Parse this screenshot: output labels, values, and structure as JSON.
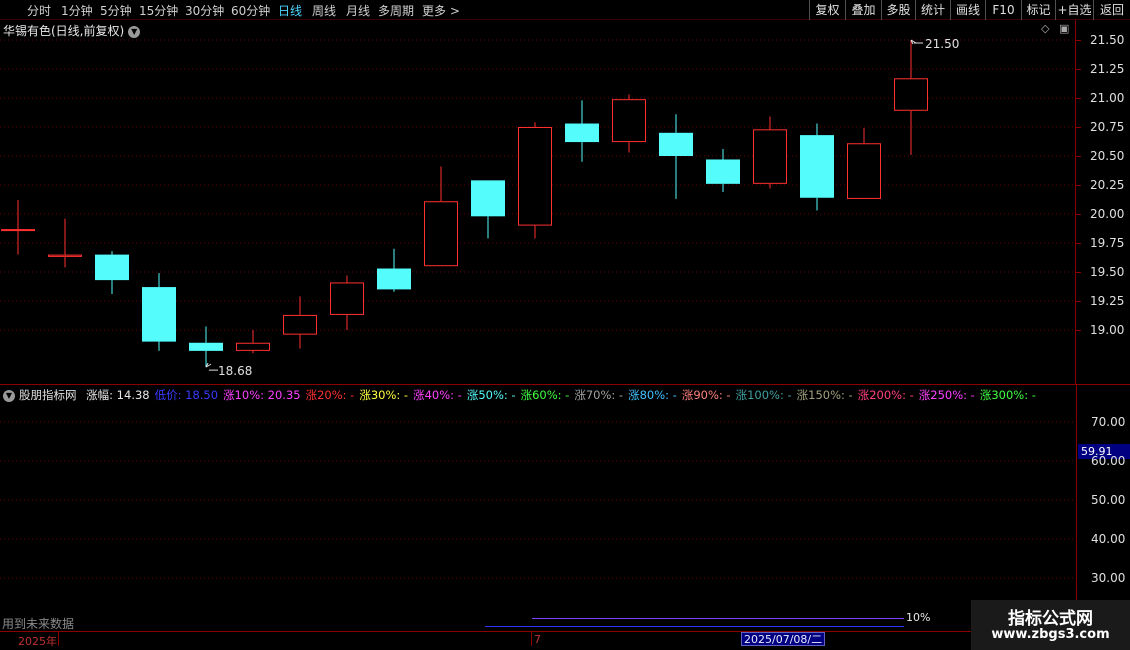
{
  "toolbar": {
    "periods": [
      "分时",
      "1分钟",
      "5分钟",
      "15分钟",
      "30分钟",
      "60分钟",
      "日线",
      "周线",
      "月线",
      "多周期",
      "更多 >"
    ],
    "active_period": "日线",
    "actions": [
      "复权",
      "叠加",
      "多股",
      "统计",
      "画线",
      "F10",
      "标记",
      "+自选",
      "返回"
    ]
  },
  "main": {
    "title": "华锡有色(日线,前复权)",
    "high_label": "21.50",
    "low_label": "18.68",
    "y_ticks": [
      "21.50",
      "21.25",
      "21.00",
      "20.75",
      "20.50",
      "20.25",
      "20.00",
      "19.75",
      "19.50",
      "19.25",
      "19.00"
    ]
  },
  "chart_data": {
    "type": "candlestick",
    "ylim": [
      18.6,
      21.7
    ],
    "up_color": "#ff3030",
    "down_color": "#54fcfc",
    "candles": [
      {
        "o": 19.87,
        "h": 20.12,
        "l": 19.65,
        "c": 19.87
      },
      {
        "o": 19.63,
        "h": 19.96,
        "l": 19.54,
        "c": 19.65
      },
      {
        "o": 19.65,
        "h": 19.68,
        "l": 19.31,
        "c": 19.43
      },
      {
        "o": 19.37,
        "h": 19.49,
        "l": 18.82,
        "c": 18.9
      },
      {
        "o": 18.89,
        "h": 19.03,
        "l": 18.68,
        "c": 18.82
      },
      {
        "o": 18.82,
        "h": 19.0,
        "l": 18.8,
        "c": 18.89
      },
      {
        "o": 18.96,
        "h": 19.29,
        "l": 18.84,
        "c": 19.13
      },
      {
        "o": 19.13,
        "h": 19.47,
        "l": 19.0,
        "c": 19.41
      },
      {
        "o": 19.53,
        "h": 19.7,
        "l": 19.33,
        "c": 19.35
      },
      {
        "o": 19.55,
        "h": 20.41,
        "l": 19.55,
        "c": 20.11
      },
      {
        "o": 20.29,
        "h": 20.29,
        "l": 19.79,
        "c": 19.98
      },
      {
        "o": 19.9,
        "h": 20.79,
        "l": 19.79,
        "c": 20.75
      },
      {
        "o": 20.78,
        "h": 20.98,
        "l": 20.45,
        "c": 20.62
      },
      {
        "o": 20.62,
        "h": 21.03,
        "l": 20.53,
        "c": 20.99
      },
      {
        "o": 20.7,
        "h": 20.86,
        "l": 20.13,
        "c": 20.5
      },
      {
        "o": 20.47,
        "h": 20.56,
        "l": 20.19,
        "c": 20.26
      },
      {
        "o": 20.26,
        "h": 20.84,
        "l": 20.22,
        "c": 20.73
      },
      {
        "o": 20.68,
        "h": 20.78,
        "l": 20.03,
        "c": 20.14
      },
      {
        "o": 20.13,
        "h": 20.74,
        "l": 20.13,
        "c": 20.61
      },
      {
        "o": 20.89,
        "h": 21.5,
        "l": 20.51,
        "c": 21.17
      }
    ]
  },
  "indicator": {
    "name": "股朋指标网",
    "items": [
      {
        "text": "涨幅: 14.38",
        "color": "#e8e8e8"
      },
      {
        "text": "低价: 18.50",
        "color": "#3a3aff"
      },
      {
        "text": "涨10%: 20.35",
        "color": "#ff40ff"
      },
      {
        "text": "涨20%: -",
        "color": "#ff3030"
      },
      {
        "text": "涨30%: -",
        "color": "#ffff40"
      },
      {
        "text": "涨40%: -",
        "color": "#ff40ff"
      },
      {
        "text": "涨50%: -",
        "color": "#54fcfc"
      },
      {
        "text": "涨60%: -",
        "color": "#40ff40"
      },
      {
        "text": "涨70%: -",
        "color": "#a0a0a0"
      },
      {
        "text": "涨80%: -",
        "color": "#40c0ff"
      },
      {
        "text": "涨90%: -",
        "color": "#ff8080"
      },
      {
        "text": "涨100%: -",
        "color": "#40a0a0"
      },
      {
        "text": "涨150%: -",
        "color": "#a0a080"
      },
      {
        "text": "涨200%: -",
        "color": "#ff4080"
      },
      {
        "text": "涨250%: -",
        "color": "#ff40ff"
      },
      {
        "text": "涨300%: -",
        "color": "#40ff40"
      }
    ],
    "y_ticks": [
      "70.00",
      "60.00",
      "50.00",
      "40.00",
      "30.00"
    ],
    "current_value": "59.91",
    "future_note": "用到未来数据",
    "pct_label": "10%"
  },
  "timeline": {
    "year_label": "2025年",
    "month_label": "7",
    "cursor_date": "2025/07/08/二"
  },
  "watermark": {
    "title": "指标公式网",
    "url": "www.zbgs3.com"
  }
}
